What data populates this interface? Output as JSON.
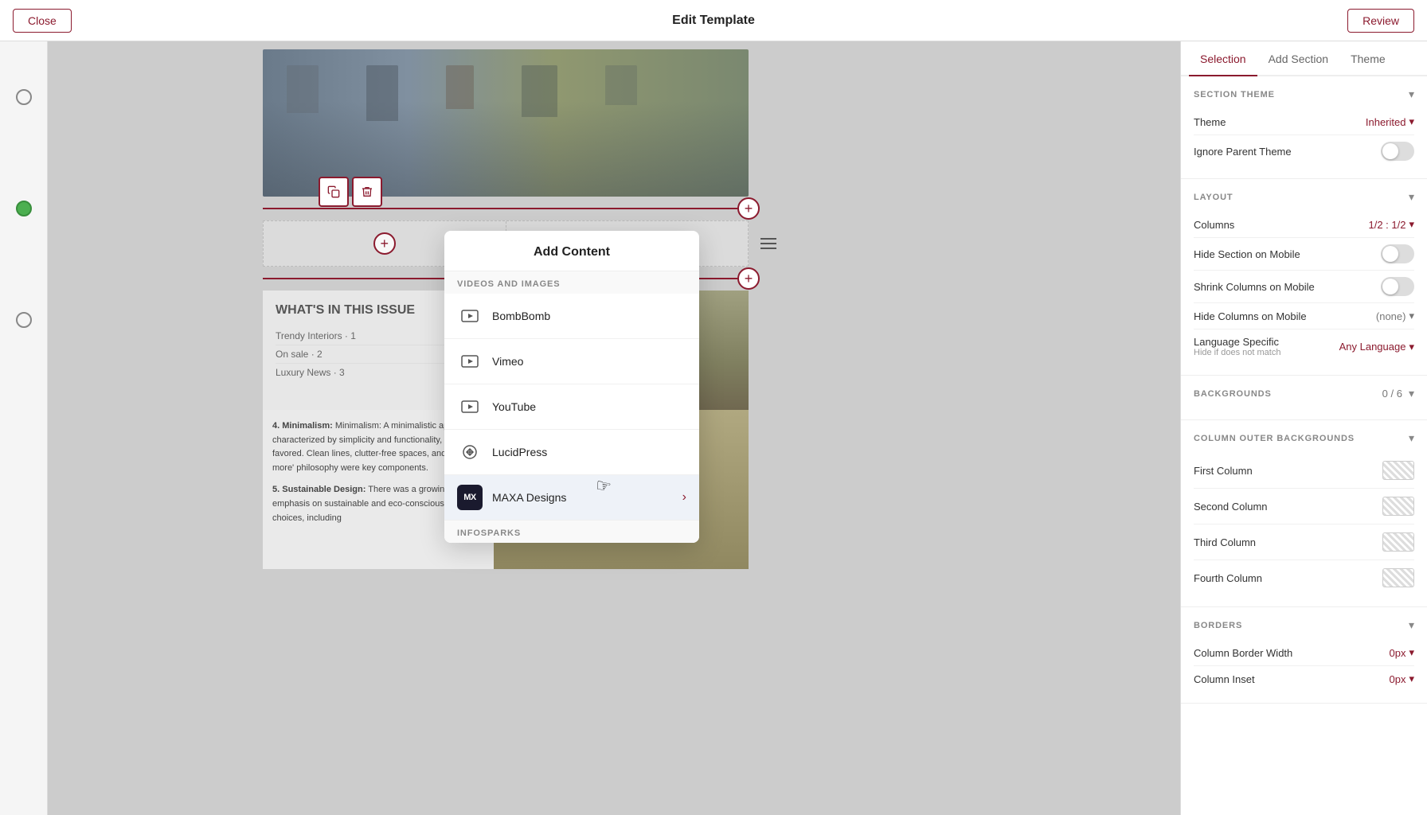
{
  "topBar": {
    "title": "Edit Template",
    "closeLabel": "Close",
    "reviewLabel": "Review"
  },
  "tabs": {
    "selection": "Selection",
    "addSection": "Add Section",
    "theme": "Theme"
  },
  "sectionTheme": {
    "title": "Section Theme",
    "themeLabel": "Theme",
    "themeValue": "Inherited",
    "ignoreParentLabel": "Ignore Parent Theme"
  },
  "layout": {
    "title": "Layout",
    "columnsLabel": "Columns",
    "columnsValue": "1/2 : 1/2",
    "hideSectionLabel": "Hide Section on Mobile",
    "shrinkColumnsLabel": "Shrink Columns on Mobile",
    "hideColumnsLabel": "Hide Columns on Mobile",
    "hideColumnsValue": "(none)",
    "languageLabel": "Language Specific",
    "languageSubLabel": "Hide if does not match",
    "languageValue": "Any Language"
  },
  "backgrounds": {
    "title": "Backgrounds",
    "value": "0 / 6"
  },
  "columnOuterBackgrounds": {
    "title": "Column Outer Backgrounds",
    "columns": [
      {
        "label": "First Column"
      },
      {
        "label": "Second Column"
      },
      {
        "label": "Third Column"
      },
      {
        "label": "Fourth Column"
      }
    ]
  },
  "borders": {
    "title": "Borders",
    "borderWidthLabel": "Column Border Width",
    "borderWidthValue": "0px",
    "borderInsetLabel": "Column Inset",
    "borderInsetValue": "0px"
  },
  "addContent": {
    "title": "Add Content",
    "videosLabel": "Videos and Images",
    "infosparksLabel": "InfoSparks",
    "items": [
      {
        "id": "bombbomb",
        "label": "BombBomb",
        "type": "video-icon"
      },
      {
        "id": "vimeo",
        "label": "Vimeo",
        "type": "video-icon"
      },
      {
        "id": "youtube",
        "label": "YouTube",
        "type": "video-icon"
      },
      {
        "id": "lucidpress",
        "label": "LucidPress",
        "type": "lucid-icon"
      },
      {
        "id": "maxa",
        "label": "MAXA Designs",
        "type": "maxa-icon",
        "highlighted": true
      }
    ]
  },
  "canvas": {
    "sectionTitle": "WHAT'S IN THIS ISSUE",
    "listItems": [
      "Trendy Interiors · 1",
      "On sale · 2",
      "Luxury News · 3"
    ],
    "lowerContent": {
      "item4": "Minimalism: A minimalistic approach, characterized by simplicity and functionality, was favored. Clean lines, clutter-free spaces, and a 'less is more' philosophy were key components.",
      "item5": "Sustainable Design: There was a growing emphasis on sustainable and eco-conscious design choices, including"
    }
  }
}
